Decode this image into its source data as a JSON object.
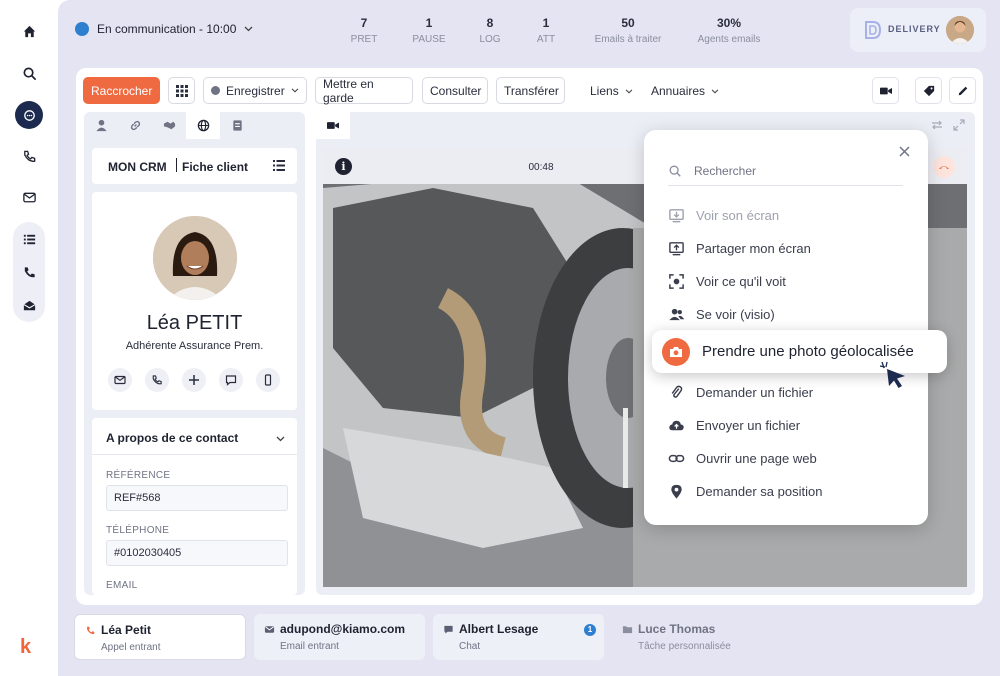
{
  "header": {
    "status_label": "En communication - 10:00",
    "stats": [
      {
        "value": "7",
        "label": "PRET"
      },
      {
        "value": "1",
        "label": "PAUSE"
      },
      {
        "value": "8",
        "label": "LOG"
      },
      {
        "value": "1",
        "label": "ATT"
      },
      {
        "value": "50",
        "label": "Emails à traiter"
      },
      {
        "value": "30%",
        "label": "Agents emails"
      }
    ],
    "brand": "DELIVERY"
  },
  "toolbar": {
    "hangup": "Raccrocher",
    "record": "Enregistrer",
    "hold": "Mettre en garde",
    "consult": "Consulter",
    "transfer": "Transférer",
    "links": "Liens",
    "directories": "Annuaires"
  },
  "crm": {
    "title": "MON CRM",
    "subtitle": "Fiche client",
    "name": "Léa PETIT",
    "role": "Adhérente Assurance Prem.",
    "about": "A propos de ce contact",
    "ref_label": "RÉFÉRENCE",
    "ref_value": "REF#568",
    "phone_label": "TÉLÉPHONE",
    "phone_value": "#0102030405",
    "email_label": "EMAIL"
  },
  "video": {
    "timer": "00:48"
  },
  "menu": {
    "search_placeholder": "Rechercher",
    "items": [
      "Voir son écran",
      "Partager mon écran",
      "Voir ce qu'il voit",
      "Se voir (visio)",
      "Prendre une photo géolocalisée",
      "Demander un fichier",
      "Envoyer un fichier",
      "Ouvrir une page web",
      "Demander sa position"
    ]
  },
  "bottom_tabs": [
    {
      "title": "Léa Petit",
      "sub": "Appel entrant"
    },
    {
      "title": "adupond@kiamo.com",
      "sub": "Email entrant"
    },
    {
      "title": "Albert Lesage",
      "sub": "Chat",
      "badge": "1"
    },
    {
      "title": "Luce Thomas",
      "sub": "Tâche personnalisée"
    }
  ],
  "colors": {
    "accent": "#ef6a41",
    "status": "#2f7fd0",
    "nav_active": "#1c2a4f"
  },
  "app_logo": "k"
}
